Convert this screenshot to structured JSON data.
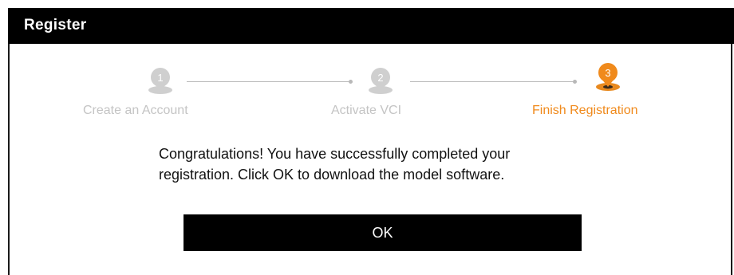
{
  "dialog": {
    "title": "Register"
  },
  "steps": [
    {
      "number": "1",
      "label": "Create an Account",
      "state": "inactive"
    },
    {
      "number": "2",
      "label": "Activate VCI",
      "state": "inactive"
    },
    {
      "number": "3",
      "label": "Finish Registration",
      "state": "active"
    }
  ],
  "colors": {
    "active": "#f08a1c",
    "inactive": "#c4c4c4",
    "titlebar": "#000000",
    "button": "#000000"
  },
  "message": {
    "line1": "Congratulations! You have successfully completed your",
    "line2": "registration. Click OK to download the model software."
  },
  "actions": {
    "ok_label": "OK"
  }
}
